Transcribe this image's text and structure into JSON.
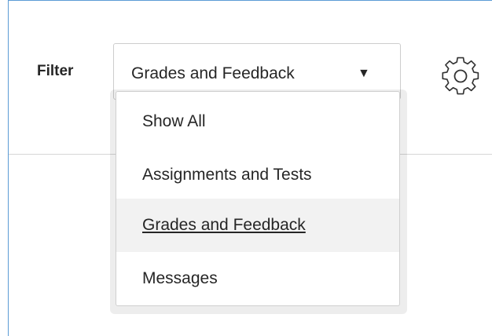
{
  "filter": {
    "label": "Filter",
    "selected_value": "Grades and Feedback",
    "arrow": "▼"
  },
  "settings": {
    "icon": "gear-icon"
  },
  "dropdown": {
    "items": [
      {
        "label": "Show All",
        "selected": false
      },
      {
        "label": "Assignments and Tests",
        "selected": false
      },
      {
        "label": "Grades and Feedback",
        "selected": true
      },
      {
        "label": "Messages",
        "selected": false
      }
    ]
  },
  "colors": {
    "panel_border": "#5b9bd5",
    "selected_item_bg": "#f2f2f2",
    "text": "#262626"
  }
}
